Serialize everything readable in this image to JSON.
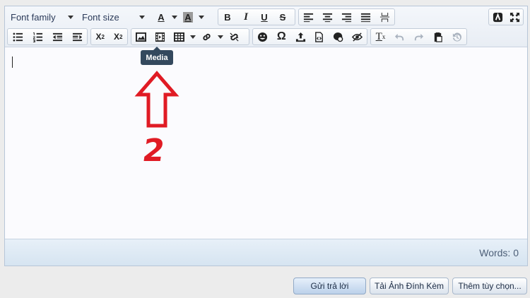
{
  "toolbar": {
    "font_family": "Font family",
    "font_size": "Font size",
    "bold": "B",
    "italic": "I",
    "underline": "U",
    "strike": "S",
    "text_color": "A",
    "bg_color": "A",
    "subscript": "X",
    "subscript_mark": "2",
    "superscript": "X",
    "superscript_mark": "2",
    "omega": "Ω",
    "clear_format": "T",
    "clear_format_mark": "x"
  },
  "tooltip": {
    "label": "Media"
  },
  "annotation": {
    "number": "2"
  },
  "statusbar": {
    "words": "Words: 0"
  },
  "actions": {
    "submit": "Gửi trả lời",
    "upload": "Tải Ảnh Đính Kèm",
    "more": "Thêm tùy chọn..."
  },
  "colors": {
    "accent": "#34495e",
    "annotation": "#e01b24"
  }
}
